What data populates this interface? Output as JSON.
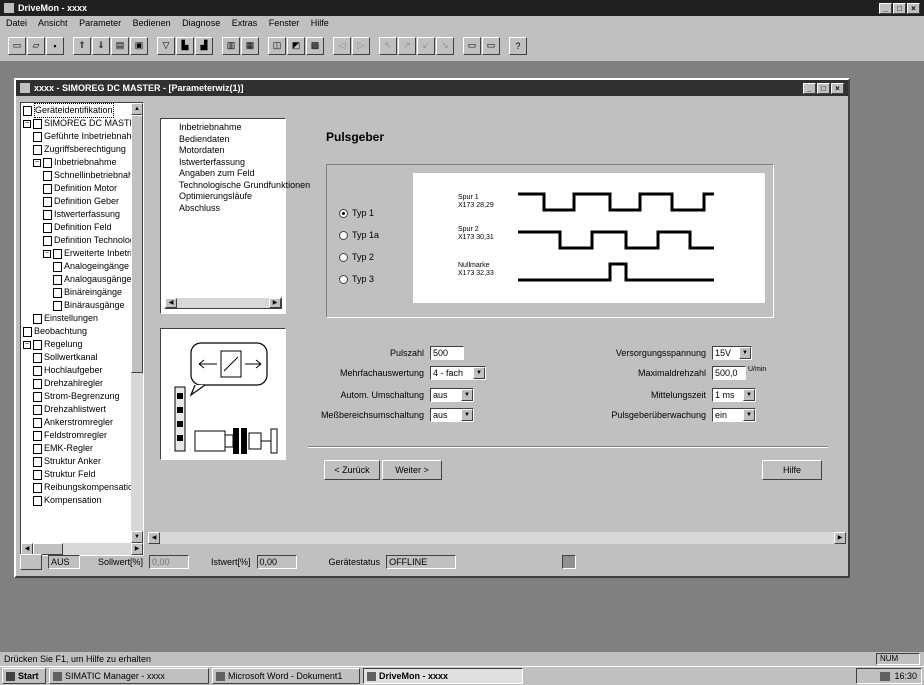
{
  "app": {
    "title": "DriveMon - xxxx",
    "menu": [
      "Datei",
      "Ansicht",
      "Parameter",
      "Bedienen",
      "Diagnose",
      "Extras",
      "Fenster",
      "Hilfe"
    ]
  },
  "child_window": {
    "title": "xxxx - SIMOREG DC MASTER - [Parameterwiz(1)]"
  },
  "tree": {
    "items": [
      {
        "label": "Geräteidentifikation",
        "level": 0,
        "kind": "doc"
      },
      {
        "label": "SIMOREG DC MASTER",
        "level": 0,
        "kind": "node"
      },
      {
        "label": "Geführte Inbetriebnahme",
        "level": 1,
        "kind": "doc"
      },
      {
        "label": "Zugriffsberechtigung",
        "level": 1,
        "kind": "doc"
      },
      {
        "label": "Inbetriebnahme",
        "level": 1,
        "kind": "node"
      },
      {
        "label": "Schnellinbetriebnahme",
        "level": 2,
        "kind": "doc"
      },
      {
        "label": "Definition Motor",
        "level": 2,
        "kind": "doc"
      },
      {
        "label": "Definition Geber",
        "level": 2,
        "kind": "doc"
      },
      {
        "label": "Istwerterfassung",
        "level": 2,
        "kind": "doc"
      },
      {
        "label": "Definition Feld",
        "level": 2,
        "kind": "doc"
      },
      {
        "label": "Definition Technologie",
        "level": 2,
        "kind": "doc"
      },
      {
        "label": "Erweiterte Inbetriebnahme",
        "level": 2,
        "kind": "node"
      },
      {
        "label": "Analogeingänge",
        "level": 3,
        "kind": "doc"
      },
      {
        "label": "Analogausgänge",
        "level": 3,
        "kind": "doc"
      },
      {
        "label": "Binäreingänge",
        "level": 3,
        "kind": "doc"
      },
      {
        "label": "Binärausgänge",
        "level": 3,
        "kind": "doc"
      },
      {
        "label": "Einstellungen",
        "level": 1,
        "kind": "doc"
      },
      {
        "label": "Beobachtung",
        "level": 0,
        "kind": "doc"
      },
      {
        "label": "Regelung",
        "level": 0,
        "kind": "node"
      },
      {
        "label": "Sollwertkanal",
        "level": 1,
        "kind": "doc"
      },
      {
        "label": "Hochlaufgeber",
        "level": 1,
        "kind": "doc"
      },
      {
        "label": "Drehzahlregler",
        "level": 1,
        "kind": "doc"
      },
      {
        "label": "Strom-Begrenzung",
        "level": 1,
        "kind": "doc"
      },
      {
        "label": "Drehzahlistwert",
        "level": 1,
        "kind": "doc"
      },
      {
        "label": "Ankerstromregler",
        "level": 1,
        "kind": "doc"
      },
      {
        "label": "Feldstromregler",
        "level": 1,
        "kind": "doc"
      },
      {
        "label": "EMK-Regler",
        "level": 1,
        "kind": "doc"
      },
      {
        "label": "Struktur Anker",
        "level": 1,
        "kind": "doc"
      },
      {
        "label": "Struktur Feld",
        "level": 1,
        "kind": "doc"
      },
      {
        "label": "Reibungskompensation",
        "level": 1,
        "kind": "doc"
      },
      {
        "label": "Kompensation",
        "level": 1,
        "kind": "doc"
      }
    ]
  },
  "wizard": {
    "nav_items": [
      "Inbetriebnahme",
      "Bediendaten",
      "Motordaten",
      "Istwerterfassung",
      "Angaben zum Feld",
      "Technologische Grundfunktionen",
      "Optimierungsläufe",
      "Abschluss"
    ],
    "page_title": "Pulsgeber",
    "types": [
      {
        "label": "Typ 1",
        "selected": true
      },
      {
        "label": "Typ 1a",
        "selected": false
      },
      {
        "label": "Typ 2",
        "selected": false
      },
      {
        "label": "Typ 3",
        "selected": false
      }
    ],
    "tracks": [
      {
        "name": "Spur 1",
        "terminal": "X173  28,29"
      },
      {
        "name": "Spur 2",
        "terminal": "X173  30,31"
      },
      {
        "name": "Nullmarke",
        "terminal": "X173  32,33"
      }
    ],
    "left_fields": [
      {
        "label": "Pulszahl",
        "value": "500",
        "dropdown": false
      },
      {
        "label": "Mehrfachauswertung",
        "value": "4 - fach",
        "dropdown": true
      },
      {
        "label": "Autom. Umschaltung",
        "value": "aus",
        "dropdown": true
      },
      {
        "label": "Meßbereichsumschaltung",
        "value": "aus",
        "dropdown": true
      }
    ],
    "right_fields": [
      {
        "label": "Versorgungsspannung",
        "value": "15V",
        "dropdown": true,
        "unit": ""
      },
      {
        "label": "Maximaldrehzahl",
        "value": "500,0",
        "dropdown": false,
        "unit": "U/min"
      },
      {
        "label": "Mittelungszeit",
        "value": "1 ms",
        "dropdown": true,
        "unit": ""
      },
      {
        "label": "Pulsgeberüberwachung",
        "value": "ein",
        "dropdown": true,
        "unit": ""
      }
    ],
    "back_label": "< Zurück",
    "next_label": "Weiter >",
    "help_label": "Hilfe"
  },
  "child_status": {
    "mode": "AUS",
    "setpoint_label": "Sollwert[%]",
    "setpoint_value": "0,00",
    "actual_label": "Istwert[%]",
    "actual_value": "0,00",
    "device_status_label": "Gerätestatus",
    "device_status_value": "OFFLINE"
  },
  "statusbar": {
    "text": "Drücken Sie F1, um Hilfe zu erhalten",
    "num": "NUM"
  },
  "taskbar": {
    "start": "Start",
    "tasks": [
      "SIMATIC Manager - xxxx",
      "Microsoft Word - Dokument1",
      "DriveMon - xxxx"
    ],
    "clock": "16:30"
  },
  "colors": {
    "desktop": "#808080",
    "face": "#c0c0c0",
    "title_active": "#202020"
  }
}
